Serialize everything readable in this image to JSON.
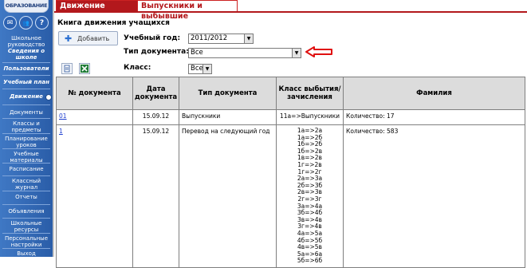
{
  "sidebar": {
    "logo_text": "ОБРАЗОВАНИЕ",
    "icons": [
      "mail-icon",
      "people-icon",
      "help-icon"
    ],
    "icon_glyphs": [
      "✉",
      "👥",
      "?"
    ],
    "items": [
      {
        "label": "Школьное руководство",
        "style": "normal"
      },
      {
        "label": "Сведения о школе",
        "style": "em"
      },
      {
        "label": "Пользователи",
        "style": "em"
      },
      {
        "label": "Учебный план",
        "style": "em"
      },
      {
        "label": "Движение",
        "style": "em"
      },
      {
        "label": "Документы",
        "style": "normal"
      },
      {
        "label": "Классы и предметы",
        "style": "normal"
      },
      {
        "label": "Планирование уроков",
        "style": "normal"
      },
      {
        "label": "Учебные материалы",
        "style": "normal"
      },
      {
        "label": "Расписание",
        "style": "normal"
      },
      {
        "label": "Классный журнал",
        "style": "normal"
      },
      {
        "label": "Отчеты",
        "style": "normal"
      },
      {
        "label": "Объявления",
        "style": "normal"
      },
      {
        "label": "Школьные ресурсы",
        "style": "normal"
      },
      {
        "label": "Персональные настройки",
        "style": "normal"
      },
      {
        "label": "Выход",
        "style": "normal"
      }
    ]
  },
  "tabs": {
    "movement": "Движение учащихся",
    "graduates": "Выпускники и выбывшие"
  },
  "page_title": "Книга движения учащихся",
  "toolbar": {
    "add_label": "Добавить"
  },
  "filters": {
    "year_label": "Учебный год:",
    "year_value": "2011/2012",
    "doctype_label": "Тип документа:",
    "doctype_value": "Все",
    "class_label": "Класс:",
    "class_value": "Все"
  },
  "table": {
    "headers": [
      "№ документа",
      "Дата документа",
      "Тип документа",
      "Класс выбытия/ зачисления",
      "Фамилия"
    ],
    "rows": [
      {
        "doc_no": "01",
        "date": "15.09.12",
        "type": "Выпускники",
        "classes": [
          "11а=>Выпускники"
        ],
        "surname": "Количество: 17"
      },
      {
        "doc_no": "1",
        "date": "15.09.12",
        "type": "Перевод на следующий год",
        "classes": [
          "1а=>2а",
          "1а=>2б",
          "1б=>2б",
          "1б=>2в",
          "1в=>2в",
          "1г=>2в",
          "1г=>2г",
          "2а=>3а",
          "2б=>3б",
          "2в=>3в",
          "2г=>3г",
          "3а=>4а",
          "3б=>4б",
          "3в=>4в",
          "3г=>4в",
          "4а=>5а",
          "4б=>5б",
          "4в=>5в",
          "5а=>6а",
          "5б=>6б"
        ],
        "surname": "Количество: 583"
      }
    ]
  }
}
